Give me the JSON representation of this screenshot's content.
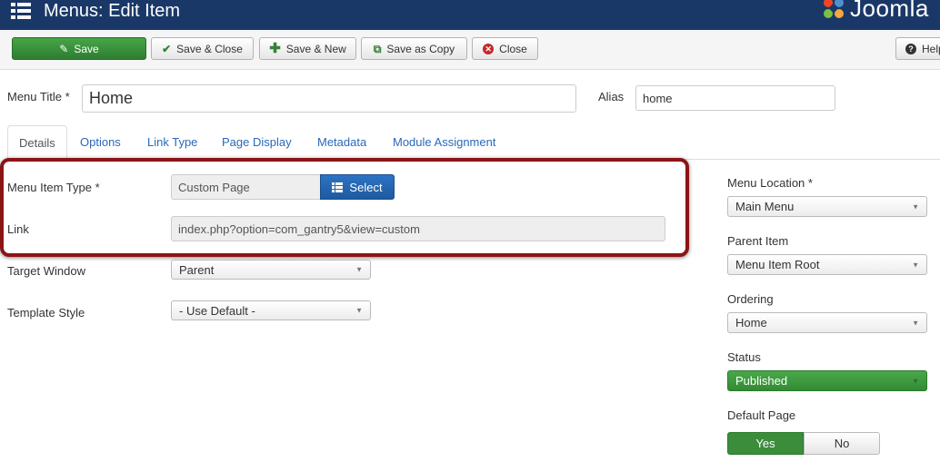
{
  "header": {
    "title": "Menus: Edit Item",
    "brand": "Joomla"
  },
  "toolbar": {
    "save": "Save",
    "save_close": "Save & Close",
    "save_new": "Save & New",
    "save_copy": "Save as Copy",
    "close": "Close",
    "help": "Help"
  },
  "form": {
    "menu_title_label": "Menu Title *",
    "menu_title_value": "Home",
    "alias_label": "Alias",
    "alias_value": "home"
  },
  "tabs": [
    "Details",
    "Options",
    "Link Type",
    "Page Display",
    "Metadata",
    "Module Assignment"
  ],
  "details": {
    "item_type_label": "Menu Item Type *",
    "item_type_value": "Custom Page",
    "select_button": "Select",
    "link_label": "Link",
    "link_value": "index.php?option=com_gantry5&view=custom",
    "target_label": "Target Window",
    "target_value": "Parent",
    "template_label": "Template Style",
    "template_value": "- Use Default -"
  },
  "sidebar": {
    "location_label": "Menu Location *",
    "location_value": "Main Menu",
    "parent_label": "Parent Item",
    "parent_value": "Menu Item Root",
    "ordering_label": "Ordering",
    "ordering_value": "Home",
    "status_label": "Status",
    "status_value": "Published",
    "default_label": "Default Page",
    "default_yes": "Yes",
    "default_no": "No"
  },
  "colors": {
    "header_bg": "#1a3867",
    "success": "#46a546",
    "primary": "#2c74c4",
    "highlight": "#8b1416",
    "link": "#2a69b8"
  }
}
